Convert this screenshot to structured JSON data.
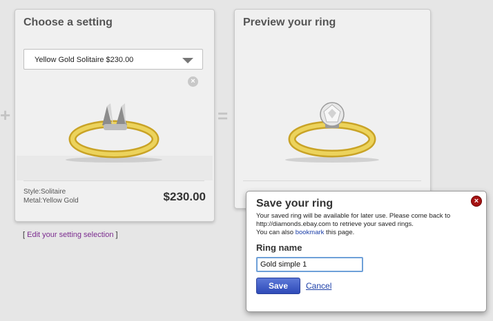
{
  "setting_panel": {
    "title": "Choose a setting",
    "select_value": "Yellow Gold Solitaire $230.00",
    "style_label": "Style:",
    "style_value": "Solitaire",
    "metal_label": "Metal:",
    "metal_value": "Yellow Gold",
    "price": "$230.00",
    "remove_icon": "x-circle-icon"
  },
  "preview_panel": {
    "title": "Preview your ring"
  },
  "operators": {
    "plus": "+",
    "equals": "="
  },
  "edit_link": {
    "open": "[",
    "label": "Edit your setting selection",
    "close": "]"
  },
  "dialog": {
    "title": "Save your ring",
    "line1": "Your saved ring will be available for later use. Please come back to",
    "line2": "http://diamonds.ebay.com to retrieve your saved rings.",
    "line3_prefix": "You can also ",
    "bookmark_link": "bookmark",
    "line3_suffix": " this page.",
    "ring_name_label": "Ring name",
    "ring_name_value": "Gold simple 1",
    "save_label": "Save",
    "cancel_label": "Cancel",
    "close_icon": "close-icon"
  },
  "colors": {
    "gold": "#d9b832",
    "save_button": "#3f5ec8",
    "link_purple": "#7b2b8f",
    "link_blue": "#1c3fa8",
    "close_red": "#a51212"
  }
}
